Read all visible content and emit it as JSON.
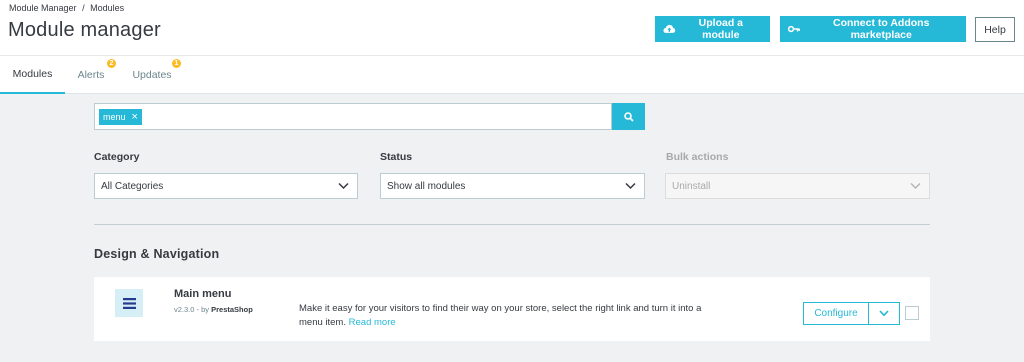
{
  "breadcrumb": [
    "Module Manager",
    "/",
    "Modules"
  ],
  "page_title": "Module manager",
  "toolbar": {
    "upload_label": "Upload a module",
    "connect_label": "Connect to Addons marketplace",
    "help_label": "Help"
  },
  "tabs": [
    {
      "label": "Modules",
      "active": true
    },
    {
      "label": "Alerts",
      "badge": "2"
    },
    {
      "label": "Updates",
      "badge": "1"
    }
  ],
  "search": {
    "tag": "menu",
    "tag_remove": "×"
  },
  "filters": {
    "category": {
      "label": "Category",
      "value": "All Categories"
    },
    "status": {
      "label": "Status",
      "value": "Show all modules"
    },
    "bulk": {
      "label": "Bulk actions",
      "value": "Uninstall",
      "disabled": true
    }
  },
  "section": {
    "title": "Design & Navigation"
  },
  "module": {
    "name": "Main menu",
    "version": "v2.3.0 - by ",
    "author": "PrestaShop",
    "description": "Make it easy for your visitors to find their way on your store, select the right link and turn it into a menu item.",
    "read_more": "Read more",
    "configure_label": "Configure"
  },
  "colors": {
    "accent": "#25b9d7",
    "badge": "#fbbb22",
    "background": "#eff1f2"
  }
}
